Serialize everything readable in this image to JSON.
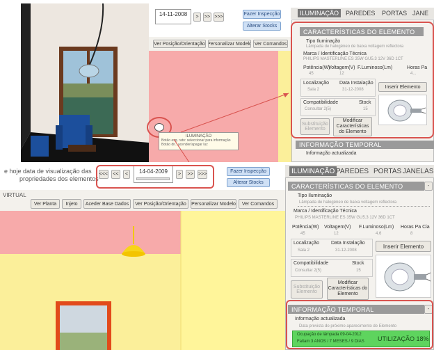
{
  "top": {
    "date": "14-11-2008",
    "nav_buttons": [
      ">",
      ">>",
      ">>>"
    ],
    "btn_inspection": "Fazer Inspecção",
    "btn_stocks": "Alterar Stocks",
    "tabs": [
      "ILUMINAÇÃO",
      "PAREDES",
      "PORTAS",
      "JANE"
    ],
    "toolbar": [
      "Ver Posição/Orientação",
      "Personalizar Modelo",
      "Ver Comandos"
    ],
    "section_title": "CARACTERÍSTICAS DO ELEMENTO",
    "tipo_label": "Tipo Iluminação",
    "tipo_value": "Lâmpada de halogéneo de baixa voltagem reflectora",
    "marca_label": "Marca / Identificação Técnica",
    "marca_value": "PHILIPS                    MASTERLINE ES 35W GU5.3 12V 36D 1CT",
    "row1_labels": [
      "Potência(W)",
      "Voltagem(V)",
      "F.Luminoso(Lm)",
      "Horas Pa"
    ],
    "row1_values": [
      "45",
      "12",
      "",
      "4..."
    ],
    "loc_label": "Localização",
    "loc_value": "Sala 2",
    "data_label": "Data Instalação",
    "data_value": "31-12-2008",
    "btn_inserir": "Inserir Elemento",
    "comp_label": "Compatibilidade",
    "comp_value": "Consultar 2(5)",
    "stock_label": "Stock",
    "stock_value": "15",
    "btn_sub": "Substituição Elemento",
    "btn_mod": "Modificar Características do Elemento",
    "temporal_title": "INFORMAÇÃO TEMPORAL",
    "temporal_line": "Informação actualizada",
    "tooltip_title": "ILUMINAÇÃO",
    "tooltip_l1": "Botão esq. rato: seleccionar para informação",
    "tooltip_l2": "Botão dir.: acender/apagar luz"
  },
  "bottom": {
    "caption_l1": "e hoje data de visualização das",
    "caption_l2": "propriedades dos elementos",
    "nav_left": [
      "<<<",
      "<<",
      "<"
    ],
    "date": "14-04-2009",
    "nav_right": [
      ">",
      ">>",
      ">>>"
    ],
    "btn_inspection": "Fazer Inspecção",
    "btn_stocks": "Alterar Stocks",
    "virtual_label": "VIRTUAL",
    "toolbar": [
      "Ver Planta",
      "Injeto",
      "Aceder Base Dados",
      "Ver Posição/Orientação",
      "Personalizar Modelo",
      "Ver Comandos"
    ],
    "tabs": [
      "ILUMINAÇÃO",
      "PAREDES",
      "PORTAS",
      "JANELAS"
    ],
    "section_title": "CARACTERÍSTICAS DO ELEMENTO",
    "tipo_label": "Tipo Iluminação",
    "tipo_value": "Lâmpada de halogéneo de baixa voltagem reflectora",
    "marca_label": "Marca / Identificação Técnica",
    "marca_value": "PHILIPS                    MASTERLINE ES 35W GU5.3 12V 36D 1CT",
    "row1_labels": [
      "Potência(W)",
      "Voltagem(V)",
      "F.Luminoso(Lm)",
      "Horas Pa Cia"
    ],
    "row1_values": [
      "45",
      "12",
      "4.6",
      "8"
    ],
    "loc_label": "Localização",
    "loc_value": "Sala 2",
    "data_label": "Data Instalação",
    "data_value": "31-12-2008",
    "btn_inserir": "Inserir Elemento",
    "comp_label": "Compatibilidade",
    "comp_value": "Consultar 2(5)",
    "stock_label": "Stock",
    "stock_value": "15",
    "btn_sub": "Substituição Elemento",
    "btn_mod": "Modificar Características do Elemento",
    "temporal_title": "INFORMAÇÃO TEMPORAL",
    "temporal_line": "Informação actualizada",
    "temporal_sub": "Data prevista do próximo aparecimento de Elemento",
    "status_l1": "Ocupação de lâmpada  09-04-2012",
    "status_l2": "Faltam  3 ANOS / 7 MESES / 9 DIAS",
    "status_pct": "UTILIZAÇÃO 18%"
  },
  "colors": {
    "wall_pink": "#f7aaaa",
    "wall_yellow": "#fbef9a",
    "status_green": "#5ed45e",
    "accent_red": "#d9534f"
  }
}
